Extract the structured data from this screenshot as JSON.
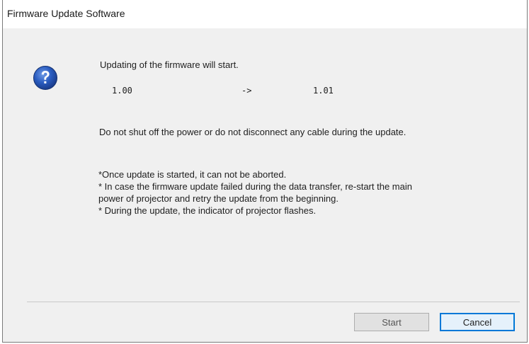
{
  "window": {
    "title": "Firmware Update Software"
  },
  "message": {
    "heading": "Updating of the firmware will start.",
    "current_version": "1.00",
    "arrow": "->",
    "new_version": "1.01",
    "warning": "Do not shut off the power or do not disconnect any cable during the update."
  },
  "notes": [
    "*Once update is started, it can not be aborted.",
    "* In case the firmware update failed during the data transfer, re-start the main",
    "power of projector and retry the update from the beginning.",
    "* During the update, the indicator of projector flashes."
  ],
  "buttons": {
    "start_label": "Start",
    "cancel_label": "Cancel"
  },
  "icons": {
    "dialog_icon": "question-icon"
  },
  "colors": {
    "icon_blue": "#1f4fa8",
    "focus_border": "#0078d7"
  }
}
